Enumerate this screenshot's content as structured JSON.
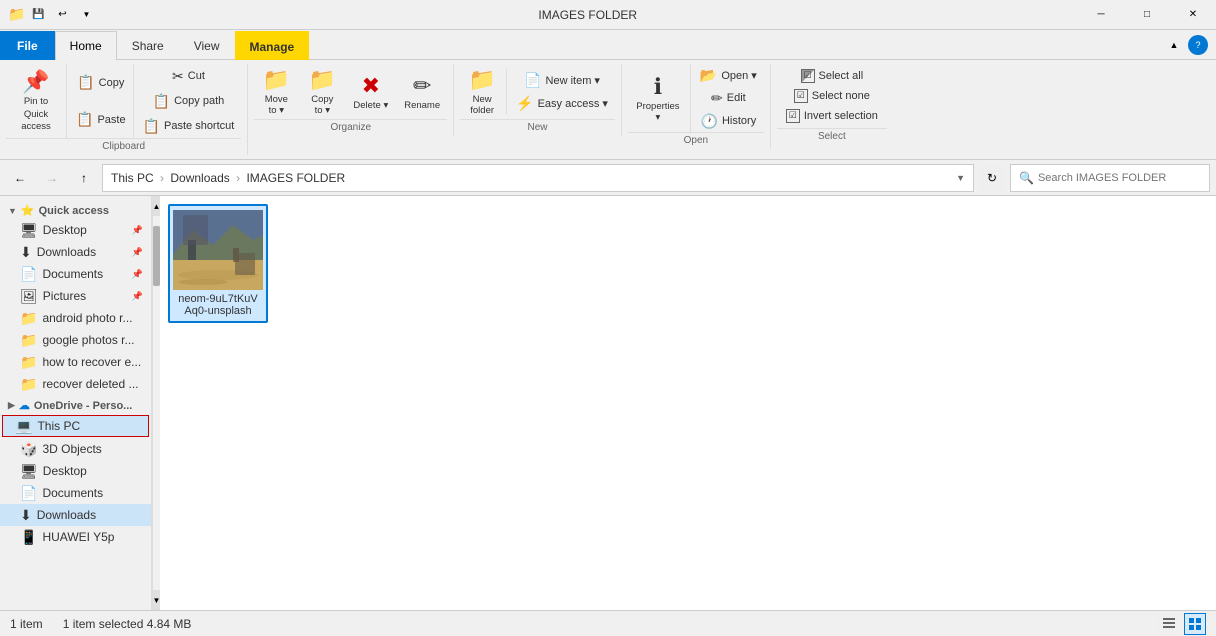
{
  "title_bar": {
    "title": "IMAGES FOLDER",
    "icons": [
      "save-icon",
      "undo-icon"
    ],
    "controls": [
      "minimize",
      "maximize",
      "close"
    ]
  },
  "ribbon": {
    "tabs": [
      "File",
      "Home",
      "Share",
      "View",
      "Manage"
    ],
    "active_tab": "Manage",
    "groups": {
      "clipboard": {
        "label": "Clipboard",
        "buttons": [
          {
            "id": "pin-quick-access",
            "icon": "📌",
            "label": "Pin to Quick\naccess"
          },
          {
            "id": "copy",
            "icon": "📋",
            "label": "Copy"
          },
          {
            "id": "paste",
            "icon": "📋",
            "label": "Paste"
          }
        ],
        "small_buttons": [
          {
            "id": "cut",
            "icon": "✂",
            "label": "Cut"
          },
          {
            "id": "copy-path",
            "icon": "📋",
            "label": "Copy path"
          },
          {
            "id": "paste-shortcut",
            "icon": "📋",
            "label": "Paste shortcut"
          }
        ]
      },
      "organize": {
        "label": "Organize",
        "buttons": [
          {
            "id": "move-to",
            "icon": "📁",
            "label": "Move\nto"
          },
          {
            "id": "copy-to",
            "icon": "📁",
            "label": "Copy\nto"
          },
          {
            "id": "delete",
            "icon": "❌",
            "label": "Delete"
          },
          {
            "id": "rename",
            "icon": "✏",
            "label": "Rename"
          }
        ]
      },
      "new": {
        "label": "New",
        "buttons": [
          {
            "id": "new-folder",
            "icon": "📁",
            "label": "New\nfolder"
          },
          {
            "id": "new-item",
            "icon": "📄",
            "label": "New item"
          },
          {
            "id": "easy-access",
            "icon": "⚡",
            "label": "Easy access"
          }
        ]
      },
      "open": {
        "label": "Open",
        "buttons": [
          {
            "id": "properties",
            "icon": "ℹ",
            "label": "Properties"
          },
          {
            "id": "open",
            "icon": "📂",
            "label": "Open"
          },
          {
            "id": "edit",
            "icon": "✏",
            "label": "Edit"
          },
          {
            "id": "history",
            "icon": "🕐",
            "label": "History"
          }
        ]
      },
      "select": {
        "label": "Select",
        "buttons": [
          {
            "id": "select-all",
            "label": "Select all"
          },
          {
            "id": "select-none",
            "label": "Select none"
          },
          {
            "id": "invert-selection",
            "label": "Invert selection"
          }
        ]
      }
    }
  },
  "navigation": {
    "back_disabled": false,
    "forward_disabled": true,
    "up_disabled": false,
    "breadcrumbs": [
      "This PC",
      "Downloads",
      "IMAGES FOLDER"
    ],
    "search_placeholder": "Search IMAGES FOLDER"
  },
  "sidebar": {
    "items": [
      {
        "id": "quick-access",
        "icon": "⭐",
        "label": "Quick access",
        "type": "section"
      },
      {
        "id": "desktop",
        "icon": "🖥",
        "label": "Desktop",
        "pin": true,
        "indent": 1
      },
      {
        "id": "downloads",
        "icon": "⬇",
        "label": "Downloads",
        "pin": true,
        "indent": 1
      },
      {
        "id": "documents",
        "icon": "📄",
        "label": "Documents",
        "pin": true,
        "indent": 1
      },
      {
        "id": "pictures",
        "icon": "🖼",
        "label": "Pictures",
        "pin": true,
        "indent": 1
      },
      {
        "id": "android-photo",
        "icon": "📁",
        "label": "android photo r...",
        "indent": 1
      },
      {
        "id": "google-photos",
        "icon": "📁",
        "label": "google photos r...",
        "indent": 1
      },
      {
        "id": "how-to-recover",
        "icon": "📁",
        "label": "how to recover e...",
        "indent": 1
      },
      {
        "id": "recover-deleted",
        "icon": "📁",
        "label": "recover deleted ...",
        "indent": 1
      },
      {
        "id": "onedrive",
        "icon": "☁",
        "label": "OneDrive - Perso...",
        "type": "section"
      },
      {
        "id": "this-pc",
        "icon": "💻",
        "label": "This PC",
        "type": "section",
        "selected": true,
        "highlight": true
      },
      {
        "id": "3d-objects",
        "icon": "🎲",
        "label": "3D Objects",
        "indent": 1
      },
      {
        "id": "desktop2",
        "icon": "🖥",
        "label": "Desktop",
        "indent": 1
      },
      {
        "id": "documents2",
        "icon": "📄",
        "label": "Documents",
        "indent": 1
      },
      {
        "id": "downloads2",
        "icon": "⬇",
        "label": "Downloads",
        "indent": 1,
        "selected": true
      },
      {
        "id": "huawei-y5p",
        "icon": "📱",
        "label": "HUAWEI Y5p",
        "indent": 1
      }
    ]
  },
  "content": {
    "files": [
      {
        "id": "neom-image",
        "name": "neom-9uL7tKuV\nAq0-unsplash",
        "type": "image",
        "selected": true
      }
    ]
  },
  "status_bar": {
    "item_count": "1 item",
    "selected_info": "1 item selected  4.84 MB",
    "view_icons": [
      "list-view",
      "grid-view"
    ]
  }
}
